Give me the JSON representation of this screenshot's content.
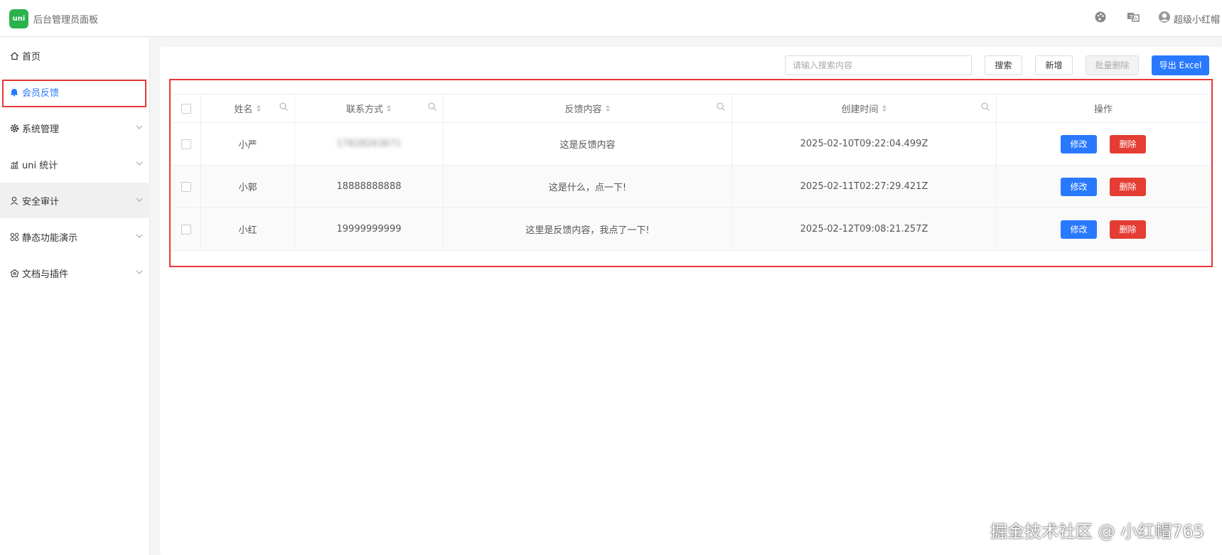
{
  "header": {
    "logo_text": "uni",
    "app_title": "后台管理员面板",
    "icons": [
      "palette-icon",
      "translate-icon",
      "user-avatar-icon"
    ],
    "username": "超级小红帽"
  },
  "sidebar": {
    "items": [
      {
        "label": "首页",
        "icon": "home-icon",
        "expandable": false
      },
      {
        "label": "会员反馈",
        "icon": "bell-icon",
        "expandable": false,
        "active": true
      },
      {
        "label": "系统管理",
        "icon": "gear-icon",
        "expandable": true
      },
      {
        "label": "uni 统计",
        "icon": "chart-icon",
        "expandable": true
      },
      {
        "label": "安全审计",
        "icon": "user-icon",
        "expandable": true
      },
      {
        "label": "静态功能演示",
        "icon": "grid-icon",
        "expandable": true
      },
      {
        "label": "文档与插件",
        "icon": "docs-icon",
        "expandable": true
      }
    ]
  },
  "toolbar": {
    "search_placeholder": "请输入搜索内容",
    "search_label": "搜索",
    "add_label": "新增",
    "batch_delete_label": "批量删除",
    "export_label": "导出 Excel"
  },
  "table": {
    "headers": [
      "姓名",
      "联系方式",
      "反馈内容",
      "创建时间",
      "操作"
    ],
    "rows": [
      {
        "name": "小严",
        "contact": "17828263671",
        "content": "这是反馈内容",
        "created": "2025-02-10T09:22:04.499Z"
      },
      {
        "name": "小郭",
        "contact": "18888888888",
        "content": "这是什么，点一下!",
        "created": "2025-02-11T02:27:29.421Z"
      },
      {
        "name": "小红",
        "contact": "19999999999",
        "content": "这里是反馈内容，我点了一下!",
        "created": "2025-02-12T09:08:21.257Z"
      }
    ],
    "edit_label": "修改",
    "delete_label": "删除"
  },
  "watermark": "掘金技术社区 @ 小红帽765",
  "colors": {
    "primary": "#2979ff",
    "danger": "#e43d33",
    "highlight": "#e53935",
    "logo": "#2bb24c"
  }
}
